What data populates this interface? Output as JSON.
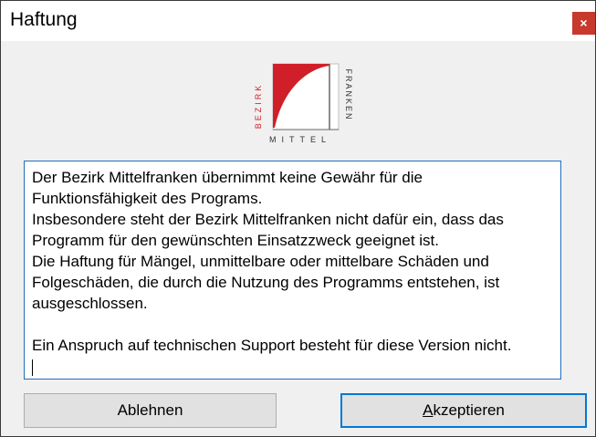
{
  "window": {
    "title": "Haftung",
    "close_glyph": "×"
  },
  "logo": {
    "vertical_left": "BEZIRK",
    "bottom": "MITTEL",
    "vertical_right": "FRANKEN",
    "accent_color": "#d01f28",
    "icon": "bezirk-mittelfranken-logo"
  },
  "disclaimer": {
    "lines": [
      "Der Bezirk Mittelfranken übernimmt keine Gewähr für die",
      "Funktionsfähigkeit des Programs.",
      "Insbesondere steht der Bezirk Mittelfranken nicht dafür ein, dass das",
      "Programm für den gewünschten Einsatzzweck geeignet ist.",
      "Die Haftung für Mängel, unmittelbare oder mittelbare Schäden und",
      "Folgeschäden, die durch die Nutzung des Programms entstehen, ist",
      "ausgeschlossen.",
      "",
      "Ein Anspruch auf technischen Support besteht für diese Version nicht."
    ]
  },
  "buttons": {
    "decline_label": "Ablehnen",
    "accept_label_mnemonic": "A",
    "accept_label_rest": "kzeptieren"
  },
  "colors": {
    "focus_border": "#0078d7",
    "close_button": "#c7392d"
  }
}
